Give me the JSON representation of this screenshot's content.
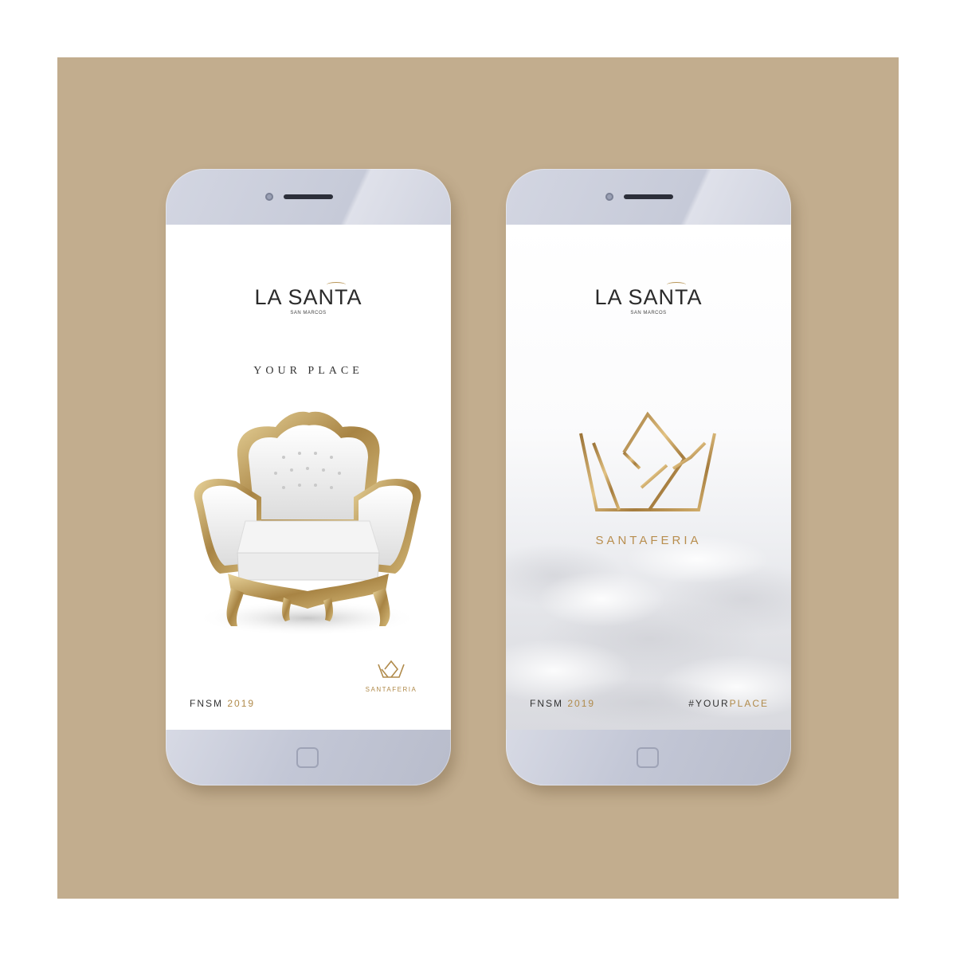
{
  "colors": {
    "background": "#c2ad8e",
    "gold": "#b08a4a",
    "phone_body": "#c6cad8",
    "text_dark": "#2a2a2a"
  },
  "left_phone": {
    "brand_main": "LA SANTA",
    "brand_sub": "SAN MARCOS",
    "tagline": "YOUR PLACE",
    "image": "white-baroque-armchair",
    "footer_label": "FNSM",
    "footer_year": "2019",
    "mini_logo_icon": "crown-icon",
    "mini_logo_part1": "SANTA",
    "mini_logo_part2": "FERIA"
  },
  "right_phone": {
    "brand_main": "LA SANTA",
    "brand_sub": "SAN MARCOS",
    "logo_icon": "crown-icon",
    "logo_part1": "SANTA",
    "logo_part2": "FERIA",
    "background_image": "clouds",
    "footer_label": "FNSM",
    "footer_year": "2019",
    "hashtag_part1": "#YOUR",
    "hashtag_part2": "PLACE"
  }
}
